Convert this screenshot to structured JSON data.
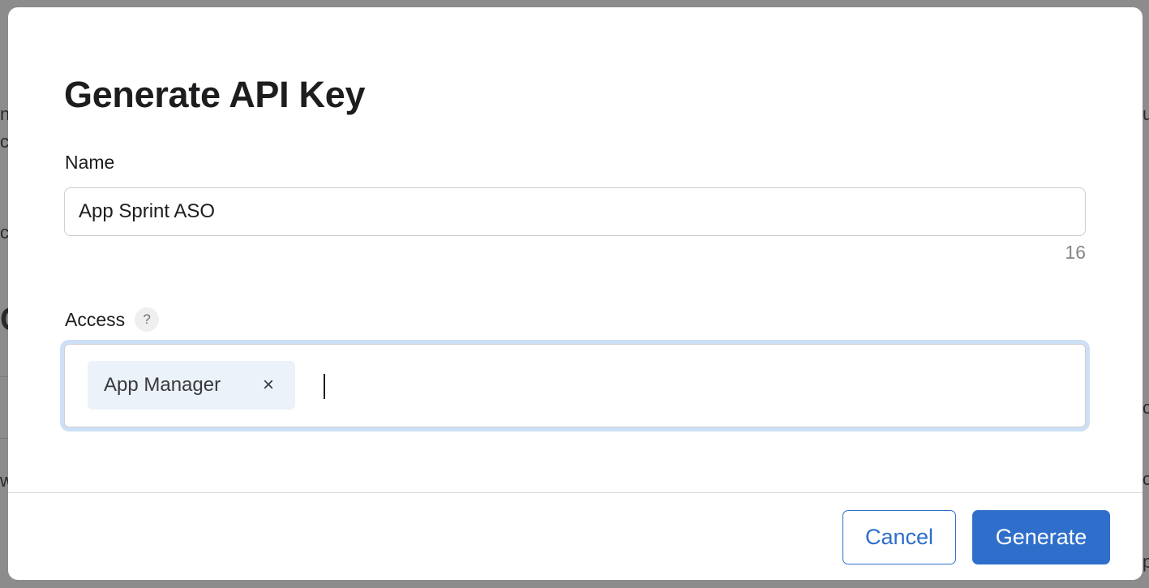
{
  "modal": {
    "title": "Generate API Key",
    "name_label": "Name",
    "name_value": "App Sprint ASO",
    "name_char_count": "16",
    "access_label": "Access",
    "access_help": "?",
    "access_tokens": [
      {
        "label": "App Manager",
        "remove": "×"
      }
    ],
    "cancel_label": "Cancel",
    "generate_label": "Generate"
  },
  "colors": {
    "accent": "#2f6fcb",
    "focus_ring": "#cde0f5",
    "token_bg": "#ebf2fa",
    "overlay": "#8c8c8c"
  },
  "icons": {
    "help": "question-mark-icon",
    "token_remove": "close-icon"
  }
}
